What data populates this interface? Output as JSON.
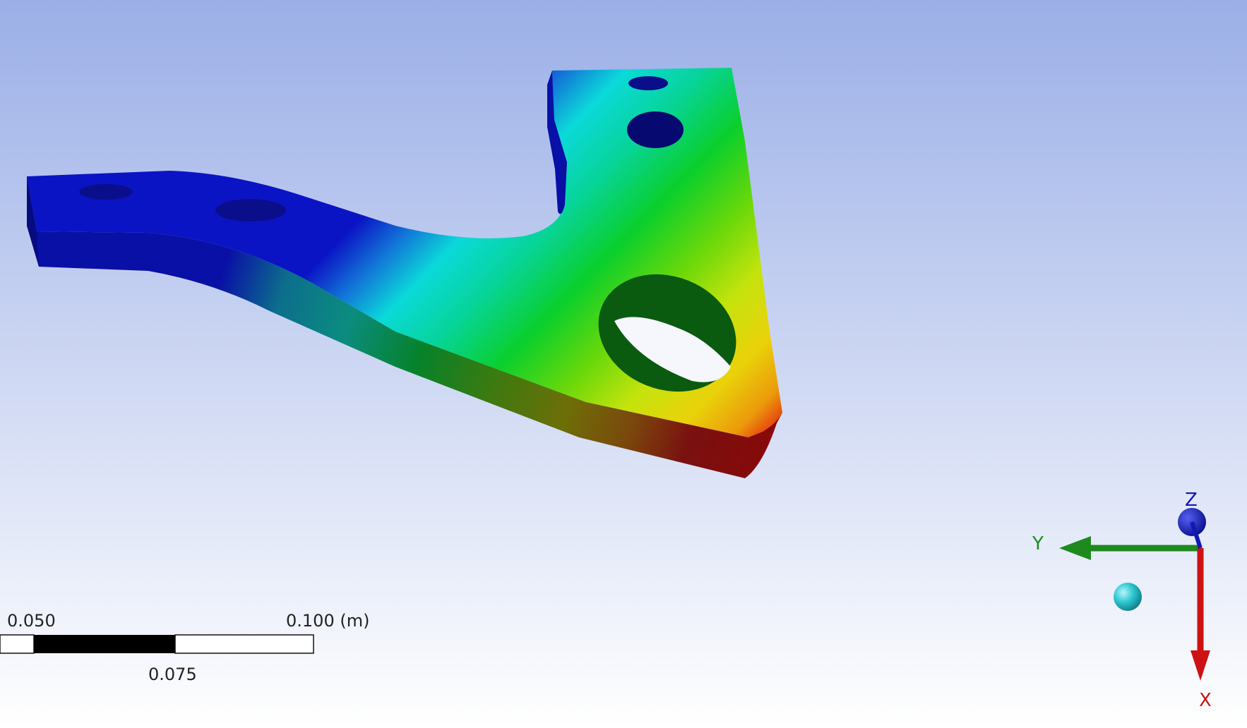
{
  "viewport": {
    "name": "3D result viewport",
    "background_top": "#9BAFE7",
    "background_bottom": "#FFFFFF"
  },
  "contour_colors": [
    "#0B14C4",
    "#1276D8",
    "#11B0E0",
    "#0BD9D9",
    "#07D49C",
    "#0ACF2C",
    "#6CD80A",
    "#C4E30D",
    "#EAD20A",
    "#EB9B0B",
    "#E51010"
  ],
  "scale_bar": {
    "left_label": "0.050",
    "right_label": "0.100 (m)",
    "mid_label": "0.075"
  },
  "triad": {
    "x_label": "X",
    "y_label": "Y",
    "z_label": "Z",
    "x_color": "#CC1212",
    "y_color": "#1E8A1E",
    "z_color": "#1018B8",
    "iso_ball_color": "#2BC8D2"
  }
}
